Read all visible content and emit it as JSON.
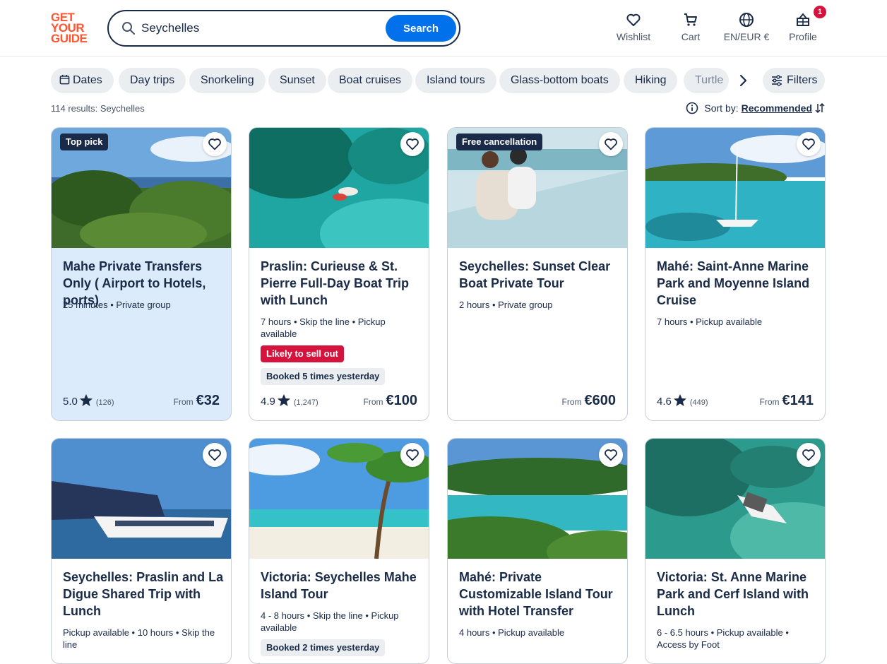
{
  "logo": {
    "line1": "GET",
    "line2": "YOUR",
    "line3": "GUIDE"
  },
  "search": {
    "value": "Seychelles",
    "button_label": "Search"
  },
  "nav": {
    "wishlist": "Wishlist",
    "cart": "Cart",
    "language": "EN/EUR €",
    "profile": "Profile",
    "profile_badge": "1"
  },
  "chips": [
    "Dates",
    "Day trips",
    "Snorkeling",
    "Sunset",
    "Boat cruises",
    "Island tours",
    "Glass-bottom boats",
    "Hiking",
    "Turtle"
  ],
  "filters_label": "Filters",
  "results_text": "114 results: Seychelles",
  "sort": {
    "label": "Sort by:",
    "value": "Recommended"
  },
  "cards": [
    {
      "tag": "Top pick",
      "title": "Mahe Private Transfers Only ( Airport to Hotels, ports)",
      "meta": "25 minutes • Private group",
      "rating": "5.0",
      "reviews": "(126)",
      "from": "From",
      "price": "€32"
    },
    {
      "tag": "",
      "title": "Praslin: Curieuse & St. Pierre Full-Day Boat Trip with Lunch",
      "meta": "7 hours • Skip the line • Pickup available",
      "sell": "Likely to sell out",
      "booked": "Booked 5 times yesterday",
      "rating": "4.9",
      "reviews": "(1,247)",
      "from": "From",
      "price": "€100"
    },
    {
      "tag": "Free cancellation",
      "title": "Seychelles: Sunset Clear Boat Private Tour",
      "meta": "2 hours • Private group",
      "from": "From",
      "price": "€600"
    },
    {
      "tag": "",
      "title": "Mahé: Saint-Anne Marine Park and Moyenne Island Cruise",
      "meta": "7 hours • Pickup available",
      "rating": "4.6",
      "reviews": "(449)",
      "from": "From",
      "price": "€141"
    },
    {
      "tag": "",
      "title": "Seychelles: Praslin and La Digue Shared Trip with Lunch",
      "meta": "Pickup available • 10 hours • Skip the line"
    },
    {
      "tag": "",
      "title": "Victoria: Seychelles Mahe Island Tour",
      "meta": "4 - 8 hours • Skip the line • Pickup available",
      "booked": "Booked 2 times yesterday"
    },
    {
      "tag": "",
      "title": "Mahé: Private Customizable Island Tour with Hotel Transfer",
      "meta": "4 hours • Pickup available"
    },
    {
      "tag": "",
      "title": "Victoria: St. Anne Marine Park and Cerf Island with Lunch",
      "meta": "6 - 6.5 hours • Pickup available • Access by Foot"
    }
  ],
  "colors": {
    "brand": "#ff5533",
    "primary": "#0071eb",
    "navy": "#1a2b49",
    "alert": "#d4143c"
  }
}
